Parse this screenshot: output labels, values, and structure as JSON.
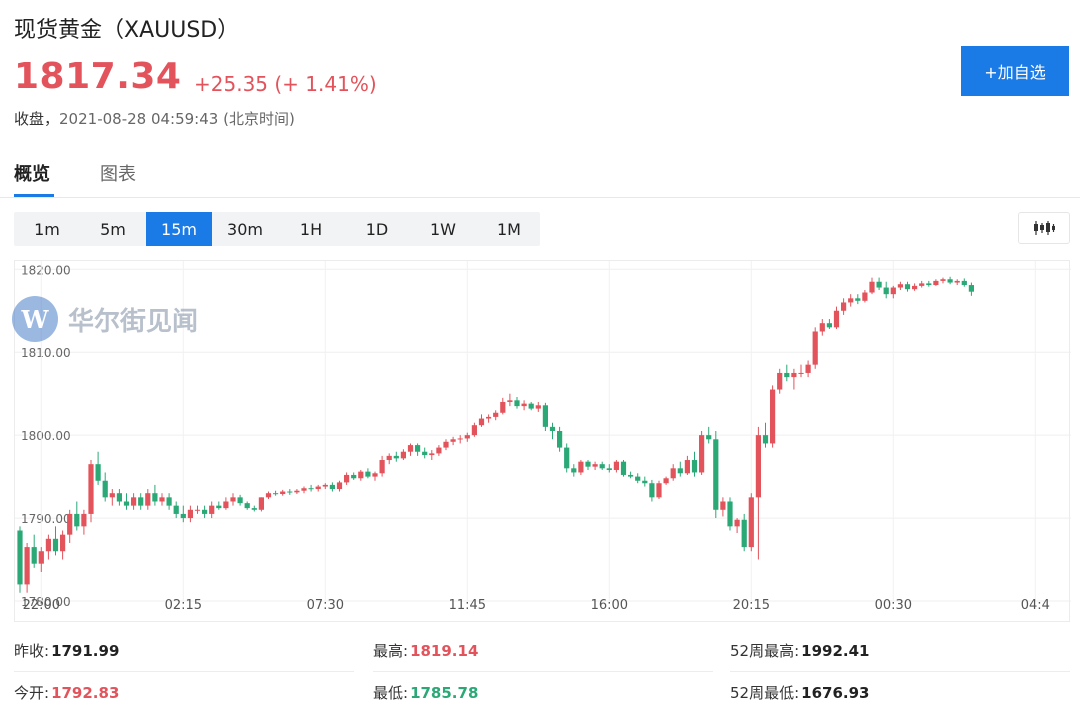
{
  "header": {
    "title": "现货黄金（XAUUSD）",
    "price": "1817.34",
    "change": "+25.35 (+ 1.41%)",
    "close_label": "收盘，",
    "close_time": "2021-08-28 04:59:43 (北京时间)",
    "add_button_label": "+加自选"
  },
  "tabs": [
    {
      "label": "概览",
      "active": true
    },
    {
      "label": "图表",
      "active": false
    }
  ],
  "periods": [
    {
      "label": "1m",
      "active": false
    },
    {
      "label": "5m",
      "active": false
    },
    {
      "label": "15m",
      "active": true
    },
    {
      "label": "30m",
      "active": false
    },
    {
      "label": "1H",
      "active": false
    },
    {
      "label": "1D",
      "active": false
    },
    {
      "label": "1W",
      "active": false
    },
    {
      "label": "1M",
      "active": false
    }
  ],
  "chart_type_icon": "candlestick-icon",
  "watermark": {
    "logo": "W",
    "text": "华尔街见闻"
  },
  "colors": {
    "up": "#e2535b",
    "down": "#2aa876",
    "accent": "#1a7ae6"
  },
  "chart_data": {
    "type": "candlestick",
    "interval": "15m",
    "y_ticks": [
      "1820.00",
      "1810.00",
      "1800.00",
      "1790.00",
      "1780.00"
    ],
    "y_tick_values": [
      1820,
      1810,
      1800,
      1790,
      1780
    ],
    "ylim": [
      1780,
      1821
    ],
    "x_ticks": [
      "22:00",
      "02:15",
      "07:30",
      "11:45",
      "16:00",
      "20:15",
      "00:30",
      "04:4"
    ],
    "x_tick_bar_index": [
      3,
      23,
      43,
      63,
      83,
      103,
      123,
      143
    ],
    "grid": true,
    "candles": [
      [
        1788.5,
        1789.0,
        1781.0,
        1782.0
      ],
      [
        1782.0,
        1787.0,
        1781.0,
        1786.5
      ],
      [
        1786.5,
        1788.0,
        1784.0,
        1784.5
      ],
      [
        1784.5,
        1786.5,
        1783.5,
        1786.0
      ],
      [
        1786.0,
        1788.0,
        1785.0,
        1787.5
      ],
      [
        1787.5,
        1789.0,
        1785.5,
        1786.0
      ],
      [
        1786.0,
        1788.5,
        1785.0,
        1788.0
      ],
      [
        1788.0,
        1791.0,
        1787.0,
        1790.5
      ],
      [
        1790.5,
        1792.0,
        1788.5,
        1789.0
      ],
      [
        1789.0,
        1791.0,
        1788.0,
        1790.5
      ],
      [
        1790.5,
        1797.0,
        1789.5,
        1796.5
      ],
      [
        1796.5,
        1798.0,
        1794.0,
        1794.5
      ],
      [
        1794.5,
        1795.5,
        1792.0,
        1792.5
      ],
      [
        1792.5,
        1793.5,
        1791.5,
        1793.0
      ],
      [
        1793.0,
        1793.5,
        1791.5,
        1792.0
      ],
      [
        1792.0,
        1793.0,
        1791.0,
        1791.5
      ],
      [
        1791.5,
        1793.0,
        1791.0,
        1792.5
      ],
      [
        1792.5,
        1793.0,
        1791.0,
        1791.5
      ],
      [
        1791.5,
        1793.5,
        1791.0,
        1793.0
      ],
      [
        1793.0,
        1794.0,
        1791.5,
        1792.0
      ],
      [
        1792.0,
        1793.0,
        1791.5,
        1792.5
      ],
      [
        1792.5,
        1793.0,
        1791.0,
        1791.5
      ],
      [
        1791.5,
        1792.0,
        1790.0,
        1790.5
      ],
      [
        1790.5,
        1791.5,
        1789.5,
        1790.0
      ],
      [
        1790.0,
        1791.5,
        1789.5,
        1791.0
      ],
      [
        1791.0,
        1791.5,
        1790.5,
        1791.0
      ],
      [
        1791.0,
        1791.5,
        1790.0,
        1790.5
      ],
      [
        1790.5,
        1792.0,
        1790.0,
        1791.5
      ],
      [
        1791.5,
        1792.0,
        1791.0,
        1791.2
      ],
      [
        1791.2,
        1792.5,
        1791.0,
        1792.0
      ],
      [
        1792.0,
        1793.0,
        1791.5,
        1792.5
      ],
      [
        1792.5,
        1792.8,
        1791.5,
        1791.8
      ],
      [
        1791.8,
        1792.0,
        1791.0,
        1791.2
      ],
      [
        1791.2,
        1791.5,
        1790.8,
        1791.0
      ],
      [
        1791.0,
        1792.5,
        1790.8,
        1792.5
      ],
      [
        1792.5,
        1793.2,
        1792.3,
        1793.0
      ],
      [
        1793.0,
        1793.3,
        1792.7,
        1792.9
      ],
      [
        1792.9,
        1793.4,
        1792.7,
        1793.2
      ],
      [
        1793.2,
        1793.5,
        1792.8,
        1793.1
      ],
      [
        1793.1,
        1793.5,
        1792.9,
        1793.3
      ],
      [
        1793.3,
        1793.8,
        1793.0,
        1793.6
      ],
      [
        1793.6,
        1794.0,
        1793.2,
        1793.5
      ],
      [
        1793.5,
        1794.0,
        1793.2,
        1793.8
      ],
      [
        1793.8,
        1794.2,
        1793.5,
        1794.0
      ],
      [
        1794.0,
        1794.3,
        1793.2,
        1793.5
      ],
      [
        1793.5,
        1794.5,
        1793.2,
        1794.3
      ],
      [
        1794.3,
        1795.5,
        1794.0,
        1795.2
      ],
      [
        1795.2,
        1795.5,
        1794.6,
        1794.8
      ],
      [
        1794.8,
        1795.8,
        1794.5,
        1795.6
      ],
      [
        1795.6,
        1796.0,
        1794.8,
        1795.0
      ],
      [
        1795.0,
        1795.6,
        1794.5,
        1795.4
      ],
      [
        1795.4,
        1797.5,
        1795.0,
        1797.0
      ],
      [
        1797.0,
        1797.8,
        1796.5,
        1797.5
      ],
      [
        1797.5,
        1798.0,
        1796.8,
        1797.2
      ],
      [
        1797.2,
        1798.3,
        1797.0,
        1798.0
      ],
      [
        1798.0,
        1799.0,
        1797.5,
        1798.8
      ],
      [
        1798.8,
        1799.0,
        1797.5,
        1798.0
      ],
      [
        1798.0,
        1798.5,
        1797.2,
        1797.6
      ],
      [
        1797.6,
        1798.2,
        1797.0,
        1797.8
      ],
      [
        1797.8,
        1798.8,
        1797.5,
        1798.5
      ],
      [
        1798.5,
        1799.5,
        1798.2,
        1799.2
      ],
      [
        1799.2,
        1799.8,
        1798.8,
        1799.5
      ],
      [
        1799.5,
        1800.0,
        1799.0,
        1799.6
      ],
      [
        1799.6,
        1800.3,
        1799.2,
        1800.0
      ],
      [
        1800.0,
        1801.5,
        1799.8,
        1801.2
      ],
      [
        1801.2,
        1802.5,
        1801.0,
        1802.0
      ],
      [
        1802.0,
        1802.5,
        1801.5,
        1802.2
      ],
      [
        1802.2,
        1803.0,
        1801.8,
        1802.7
      ],
      [
        1802.7,
        1804.5,
        1802.5,
        1804.0
      ],
      [
        1804.0,
        1805.0,
        1803.5,
        1804.2
      ],
      [
        1804.2,
        1804.6,
        1803.2,
        1803.5
      ],
      [
        1803.5,
        1804.2,
        1803.0,
        1803.8
      ],
      [
        1803.8,
        1804.0,
        1803.0,
        1803.2
      ],
      [
        1803.2,
        1804.0,
        1802.8,
        1803.6
      ],
      [
        1803.6,
        1803.9,
        1800.5,
        1801.0
      ],
      [
        1801.0,
        1801.5,
        1799.5,
        1800.5
      ],
      [
        1800.5,
        1801.0,
        1798.0,
        1798.5
      ],
      [
        1798.5,
        1799.0,
        1795.5,
        1796.0
      ],
      [
        1796.0,
        1796.5,
        1795.0,
        1795.5
      ],
      [
        1795.5,
        1797.0,
        1795.2,
        1796.8
      ],
      [
        1796.8,
        1797.0,
        1795.8,
        1796.2
      ],
      [
        1796.2,
        1796.8,
        1795.8,
        1796.5
      ],
      [
        1796.5,
        1796.8,
        1795.8,
        1796.0
      ],
      [
        1796.0,
        1796.5,
        1795.5,
        1795.8
      ],
      [
        1795.8,
        1797.0,
        1795.5,
        1796.8
      ],
      [
        1796.8,
        1797.0,
        1795.0,
        1795.2
      ],
      [
        1795.2,
        1795.6,
        1794.8,
        1795.0
      ],
      [
        1795.0,
        1795.4,
        1794.2,
        1794.5
      ],
      [
        1794.5,
        1795.0,
        1793.8,
        1794.2
      ],
      [
        1794.2,
        1794.6,
        1792.0,
        1792.5
      ],
      [
        1792.5,
        1794.5,
        1792.3,
        1794.2
      ],
      [
        1794.2,
        1795.0,
        1794.0,
        1794.8
      ],
      [
        1794.8,
        1796.5,
        1794.5,
        1796.0
      ],
      [
        1796.0,
        1796.8,
        1795.0,
        1795.4
      ],
      [
        1795.4,
        1797.5,
        1795.2,
        1797.0
      ],
      [
        1797.0,
        1798.0,
        1795.0,
        1795.5
      ],
      [
        1795.5,
        1800.5,
        1795.2,
        1800.0
      ],
      [
        1800.0,
        1801.0,
        1799.0,
        1799.5
      ],
      [
        1799.5,
        1800.5,
        1790.0,
        1791.0
      ],
      [
        1791.0,
        1792.5,
        1790.2,
        1792.0
      ],
      [
        1792.0,
        1792.5,
        1788.5,
        1789.0
      ],
      [
        1789.0,
        1790.0,
        1788.2,
        1789.8
      ],
      [
        1789.8,
        1790.5,
        1786.0,
        1786.5
      ],
      [
        1786.5,
        1793.0,
        1786.0,
        1792.5
      ],
      [
        1792.5,
        1801.0,
        1785.0,
        1800.0
      ],
      [
        1800.0,
        1801.5,
        1798.5,
        1799.0
      ],
      [
        1799.0,
        1806.0,
        1798.5,
        1805.5
      ],
      [
        1805.5,
        1808.0,
        1805.0,
        1807.5
      ],
      [
        1807.5,
        1808.5,
        1806.5,
        1807.0
      ],
      [
        1807.0,
        1808.0,
        1805.5,
        1807.5
      ],
      [
        1807.5,
        1808.5,
        1807.0,
        1807.5
      ],
      [
        1807.5,
        1809.0,
        1807.0,
        1808.5
      ],
      [
        1808.5,
        1813.0,
        1808.0,
        1812.5
      ],
      [
        1812.5,
        1814.0,
        1812.0,
        1813.5
      ],
      [
        1813.5,
        1814.0,
        1812.8,
        1813.0
      ],
      [
        1813.0,
        1815.5,
        1812.8,
        1815.0
      ],
      [
        1815.0,
        1816.5,
        1814.5,
        1816.0
      ],
      [
        1816.0,
        1817.0,
        1815.5,
        1816.5
      ],
      [
        1816.5,
        1817.0,
        1815.8,
        1816.2
      ],
      [
        1816.2,
        1817.5,
        1816.0,
        1817.2
      ],
      [
        1817.2,
        1819.0,
        1817.0,
        1818.5
      ],
      [
        1818.5,
        1819.0,
        1817.5,
        1817.8
      ],
      [
        1817.8,
        1818.5,
        1816.5,
        1817.0
      ],
      [
        1817.0,
        1818.0,
        1816.5,
        1817.8
      ],
      [
        1817.8,
        1818.5,
        1817.5,
        1818.2
      ],
      [
        1818.2,
        1818.5,
        1817.3,
        1817.6
      ],
      [
        1817.6,
        1818.3,
        1817.4,
        1818.0
      ],
      [
        1818.0,
        1818.6,
        1817.8,
        1818.3
      ],
      [
        1818.3,
        1818.6,
        1817.9,
        1818.1
      ],
      [
        1818.1,
        1818.8,
        1818.0,
        1818.6
      ],
      [
        1818.6,
        1819.0,
        1818.3,
        1818.8
      ],
      [
        1818.8,
        1819.1,
        1818.2,
        1818.4
      ],
      [
        1818.4,
        1818.8,
        1818.1,
        1818.6
      ],
      [
        1818.6,
        1818.9,
        1817.9,
        1818.1
      ],
      [
        1818.1,
        1818.4,
        1816.8,
        1817.3
      ]
    ]
  },
  "stats": {
    "prev_close_label": "昨收:",
    "prev_close": "1791.99",
    "open_label": "今开:",
    "open": "1792.83",
    "high_label": "最高:",
    "high": "1819.14",
    "low_label": "最低:",
    "low": "1785.78",
    "w52_high_label": "52周最高:",
    "w52_high": "1992.41",
    "w52_low_label": "52周最低:",
    "w52_low": "1676.93"
  }
}
